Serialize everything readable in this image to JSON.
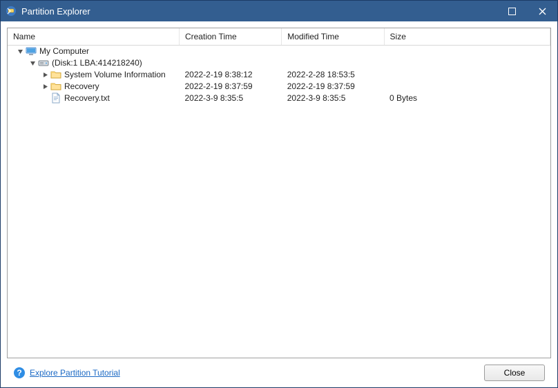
{
  "window": {
    "title": "Partition Explorer"
  },
  "columns": {
    "name": "Name",
    "creation": "Creation Time",
    "modified": "Modified Time",
    "size": "Size"
  },
  "column_widths": {
    "name": 248,
    "creation": 148,
    "modified": 148,
    "size": 240
  },
  "tree": {
    "root": {
      "label": "My Computer",
      "children": [
        {
          "label": "(Disk:1 LBA:414218240)",
          "icon": "disk",
          "children": [
            {
              "label": "System Volume Information",
              "icon": "folder",
              "expandable": true,
              "creation": "2022-2-19 8:38:12",
              "modified": "2022-2-28 18:53:5",
              "size": ""
            },
            {
              "label": "Recovery",
              "icon": "folder",
              "expandable": true,
              "creation": "2022-2-19 8:37:59",
              "modified": "2022-2-19 8:37:59",
              "size": ""
            },
            {
              "label": "Recovery.txt",
              "icon": "file",
              "expandable": false,
              "creation": "2022-3-9 8:35:5",
              "modified": "2022-3-9 8:35:5",
              "size": "0 Bytes"
            }
          ]
        }
      ]
    }
  },
  "footer": {
    "tutorial_link": "Explore Partition Tutorial",
    "close_button": "Close"
  }
}
